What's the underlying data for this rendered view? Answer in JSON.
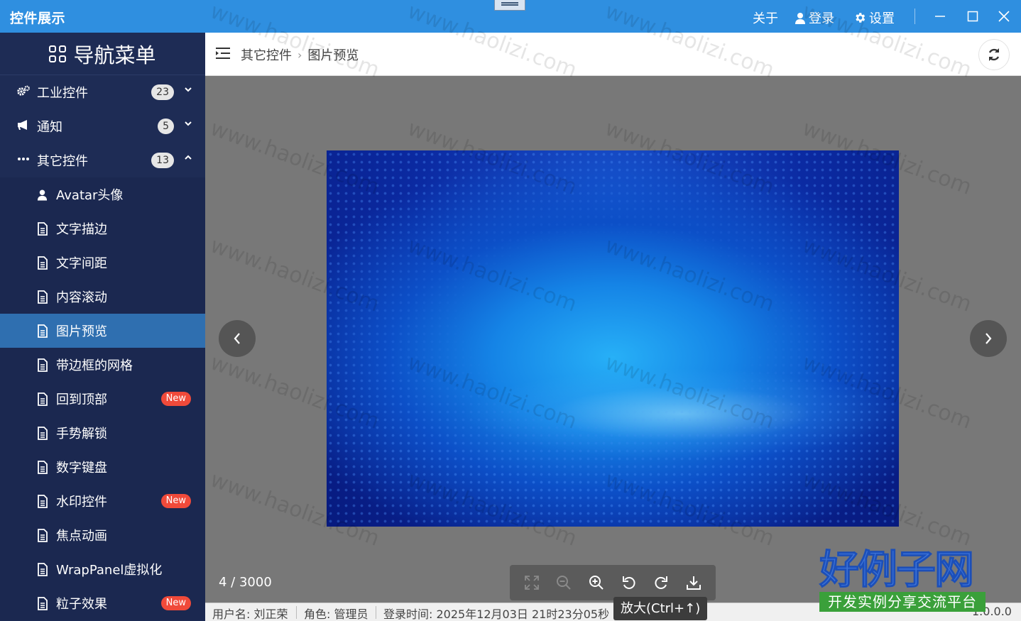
{
  "window": {
    "title": "控件展示",
    "links": {
      "about": "关于",
      "login": "登录",
      "settings": "设置"
    }
  },
  "sidebar": {
    "title": "导航菜单",
    "groups": [
      {
        "label": "工业控件",
        "badge": "23",
        "icon": "cogs-icon",
        "expanded": false
      },
      {
        "label": "通知",
        "badge": "5",
        "icon": "bullhorn-icon",
        "expanded": false
      },
      {
        "label": "其它控件",
        "badge": "13",
        "icon": "ellipsis-icon",
        "expanded": true
      }
    ],
    "items": [
      {
        "label": "Avatar头像",
        "icon": "user-icon"
      },
      {
        "label": "文字描边",
        "icon": "document-icon"
      },
      {
        "label": "文字间距",
        "icon": "document-icon"
      },
      {
        "label": "内容滚动",
        "icon": "document-icon"
      },
      {
        "label": "图片预览",
        "icon": "document-icon",
        "active": true
      },
      {
        "label": "带边框的网格",
        "icon": "document-icon"
      },
      {
        "label": "回到顶部",
        "icon": "document-icon",
        "tag": "New"
      },
      {
        "label": "手势解锁",
        "icon": "document-icon"
      },
      {
        "label": "数字键盘",
        "icon": "document-icon"
      },
      {
        "label": "水印控件",
        "icon": "document-icon",
        "tag": "New"
      },
      {
        "label": "焦点动画",
        "icon": "document-icon"
      },
      {
        "label": "WrapPanel虚拟化",
        "icon": "document-icon"
      },
      {
        "label": "粒子效果",
        "icon": "document-icon",
        "tag": "New"
      }
    ]
  },
  "breadcrumb": {
    "parent": "其它控件",
    "current": "图片预览"
  },
  "preview": {
    "counter": "4 / 3000",
    "tooltip": "放大(Ctrl+↑)"
  },
  "statusbar": {
    "user": "用户名: 刘正荣",
    "role": "角色: 管理员",
    "login_time": "登录时间: 2025年12月03日 21时23分05秒",
    "version": "1.0.0.0"
  },
  "logo": {
    "big": "好例子网",
    "small": "开发实例分享交流平台"
  },
  "watermark": {
    "text": "www.haolizi.com"
  },
  "colors": {
    "titlebar": "#2f8fe0",
    "sidebar": "#1e2c55",
    "active_item": "#2f6fb0",
    "new_badge": "#f04a3a"
  }
}
